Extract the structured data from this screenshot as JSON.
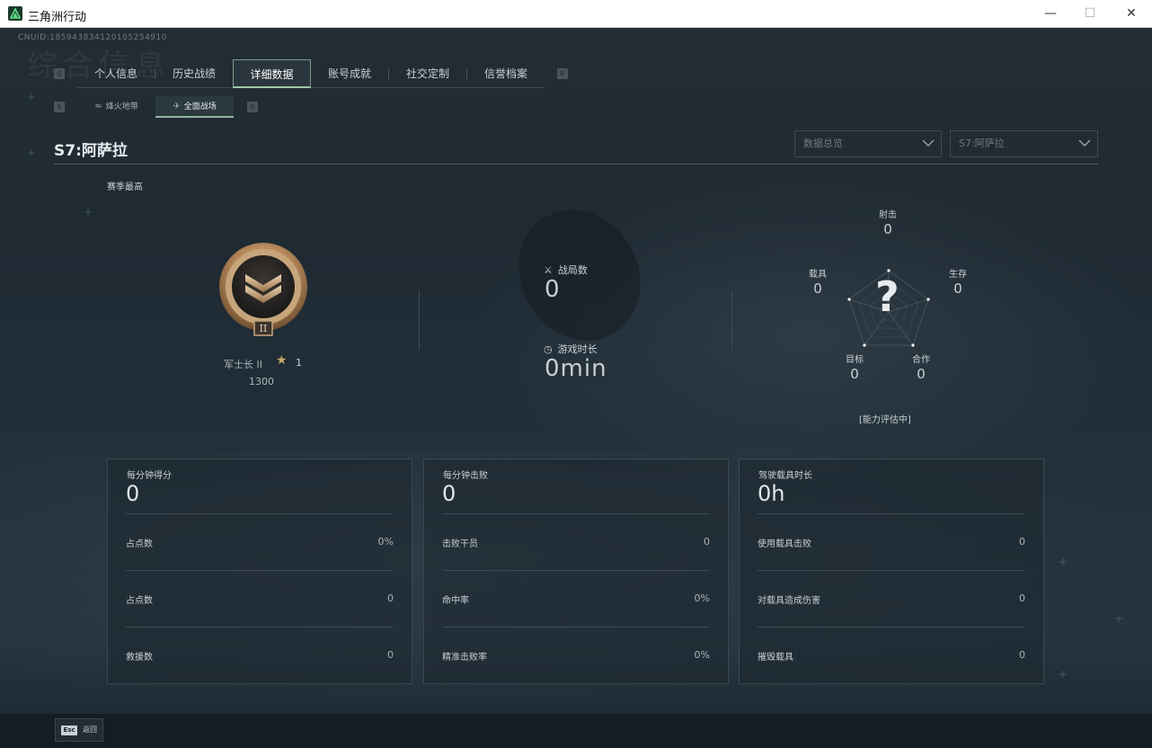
{
  "window": {
    "title": "三角洲行动",
    "min": "—",
    "max": "☐",
    "close": "✕"
  },
  "uid": "CNUID:185943834120105254910",
  "ghost_title": "综合信息",
  "tabs": [
    {
      "label": "个人信息",
      "active": false
    },
    {
      "label": "历史战绩",
      "active": false
    },
    {
      "label": "详细数据",
      "active": true
    },
    {
      "label": "账号成就",
      "active": false
    },
    {
      "label": "社交定制",
      "active": false
    },
    {
      "label": "信誉档案",
      "active": false
    }
  ],
  "tab_keys": {
    "left": "Q",
    "right": "E"
  },
  "subtabs": [
    {
      "label": "烽火地带",
      "icon": "≈",
      "active": false
    },
    {
      "label": "全面战场",
      "icon": "✈",
      "active": true
    }
  ],
  "subtab_keys": {
    "left": "A",
    "right": "D"
  },
  "season_title": "S7:阿萨拉",
  "dropdowns": [
    {
      "value": "数据总览"
    },
    {
      "value": "S7:阿萨拉"
    }
  ],
  "season_best_label": "赛季最高",
  "rank": {
    "name": "军士长 II",
    "stars": "1",
    "score": "1300",
    "roman": "II",
    "star_glyph": "★"
  },
  "center_stats": [
    {
      "label": "战局数",
      "value": "0",
      "icon": "⚔"
    },
    {
      "label": "游戏时长",
      "value": "0min",
      "icon": "◷"
    }
  ],
  "radar": {
    "axes": [
      {
        "label": "射击",
        "value": "0"
      },
      {
        "label": "生存",
        "value": "0"
      },
      {
        "label": "合作",
        "value": "0"
      },
      {
        "label": "目标",
        "value": "0"
      },
      {
        "label": "载具",
        "value": "0"
      }
    ],
    "center": "?",
    "status": "[能力评估中]"
  },
  "cards": [
    {
      "title": "每分钟得分",
      "value": "0",
      "rows": [
        {
          "label": "占点数",
          "value": "0%"
        },
        {
          "label": "占点数",
          "value": "0"
        },
        {
          "label": "救援数",
          "value": "0"
        }
      ]
    },
    {
      "title": "每分钟击败",
      "value": "0",
      "rows": [
        {
          "label": "击败干员",
          "value": "0"
        },
        {
          "label": "命中率",
          "value": "0%"
        },
        {
          "label": "精准击败率",
          "value": "0%"
        }
      ]
    },
    {
      "title": "驾驶载具时长",
      "value": "0h",
      "rows": [
        {
          "label": "使用载具击败",
          "value": "0"
        },
        {
          "label": "对载具造成伤害",
          "value": "0"
        },
        {
          "label": "摧毁载具",
          "value": "0"
        }
      ]
    }
  ],
  "bottom": {
    "esc_key": "Esc",
    "back_label": "返回"
  },
  "colors": {
    "accent": "#9cc8a6",
    "background": "#1b242c",
    "rank_gold": "#c8a86a"
  }
}
